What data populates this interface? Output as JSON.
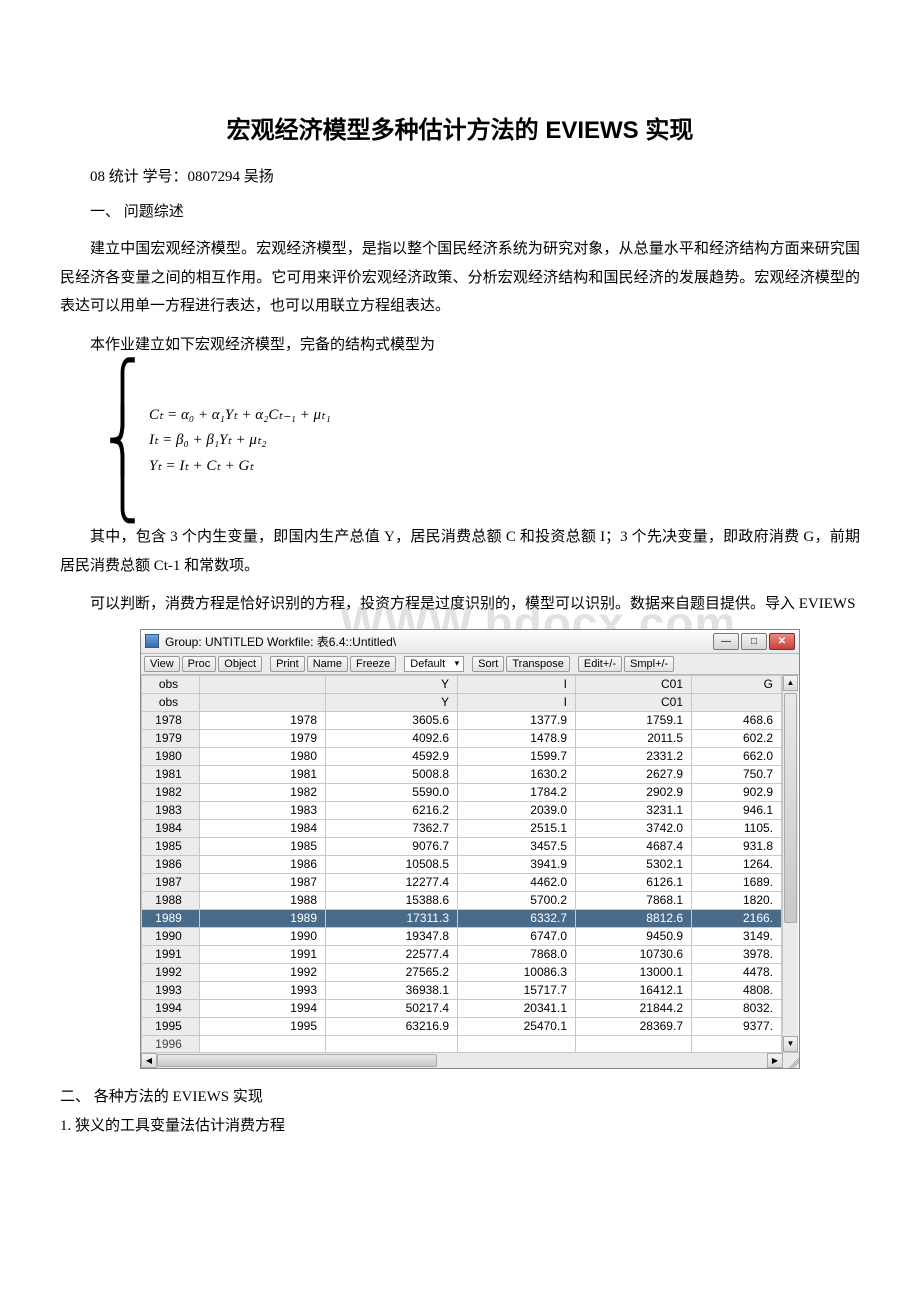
{
  "title": "宏观经济模型多种估计方法的 EVIEWS 实现",
  "byline": "08 统计  学号：0807294   吴扬",
  "section1_head": "一、 问题综述",
  "para1": "建立中国宏观经济模型。宏观经济模型，是指以整个国民经济系统为研究对象，从总量水平和经济结构方面来研究国民经济各变量之间的相互作用。它可用来评价宏观经济政策、分析宏观经济结构和国民经济的发展趋势。宏观经济模型的表达可以用单一方程进行表达，也可以用联立方程组表达。",
  "para2": "本作业建立如下宏观经济模型，完备的结构式模型为",
  "formula": {
    "line1": "Cₜ = α₀ + α₁Yₜ + α₂Cₜ₋₁ + μₜ₁",
    "line2": "Iₜ = β₀ + β₁Yₜ + μₜ₂",
    "line3": "Yₜ = Iₜ + Cₜ + Gₜ"
  },
  "para3": "其中，包含 3 个内生变量，即国内生产总值 Y，居民消费总额 C 和投资总额 I；3 个先决变量，即政府消费 G，前期居民消费总额 Ct-1 和常数项。",
  "para4": "可以判断，消费方程是恰好识别的方程，投资方程是过度识别的，模型可以识别。数据来自题目提供。导入 EVIEWS",
  "watermark": "WWW.bdocx.com",
  "app": {
    "titlebar": "Group: UNTITLED   Workfile: 表6.4::Untitled\\",
    "win_min": "—",
    "win_max": "□",
    "win_close": "✕",
    "toolbar": {
      "view": "View",
      "proc": "Proc",
      "object": "Object",
      "print": "Print",
      "name": "Name",
      "freeze": "Freeze",
      "default_sel": "Default",
      "sort": "Sort",
      "transpose": "Transpose",
      "edit": "Edit+/-",
      "smpl": "Smpl+/-"
    },
    "headers": {
      "obs": "obs",
      "c1": "",
      "c2": "Y",
      "c3": "I",
      "c4": "C01",
      "c5": "G"
    },
    "headers2": {
      "obs": "obs",
      "c1": "",
      "c2": "Y",
      "c3": "I",
      "c4": "C01",
      "c5": ""
    },
    "rows": [
      {
        "obs": "1978",
        "a": "1978",
        "b": "3605.6",
        "c": "1377.9",
        "d": "1759.1",
        "e": "468.6"
      },
      {
        "obs": "1979",
        "a": "1979",
        "b": "4092.6",
        "c": "1478.9",
        "d": "2011.5",
        "e": "602.2"
      },
      {
        "obs": "1980",
        "a": "1980",
        "b": "4592.9",
        "c": "1599.7",
        "d": "2331.2",
        "e": "662.0"
      },
      {
        "obs": "1981",
        "a": "1981",
        "b": "5008.8",
        "c": "1630.2",
        "d": "2627.9",
        "e": "750.7"
      },
      {
        "obs": "1982",
        "a": "1982",
        "b": "5590.0",
        "c": "1784.2",
        "d": "2902.9",
        "e": "902.9"
      },
      {
        "obs": "1983",
        "a": "1983",
        "b": "6216.2",
        "c": "2039.0",
        "d": "3231.1",
        "e": "946.1"
      },
      {
        "obs": "1984",
        "a": "1984",
        "b": "7362.7",
        "c": "2515.1",
        "d": "3742.0",
        "e": "1105."
      },
      {
        "obs": "1985",
        "a": "1985",
        "b": "9076.7",
        "c": "3457.5",
        "d": "4687.4",
        "e": "931.8"
      },
      {
        "obs": "1986",
        "a": "1986",
        "b": "10508.5",
        "c": "3941.9",
        "d": "5302.1",
        "e": "1264."
      },
      {
        "obs": "1987",
        "a": "1987",
        "b": "12277.4",
        "c": "4462.0",
        "d": "6126.1",
        "e": "1689."
      },
      {
        "obs": "1988",
        "a": "1988",
        "b": "15388.6",
        "c": "5700.2",
        "d": "7868.1",
        "e": "1820."
      },
      {
        "obs": "1989",
        "a": "1989",
        "b": "17311.3",
        "c": "6332.7",
        "d": "8812.6",
        "e": "2166.",
        "sel": true
      },
      {
        "obs": "1990",
        "a": "1990",
        "b": "19347.8",
        "c": "6747.0",
        "d": "9450.9",
        "e": "3149."
      },
      {
        "obs": "1991",
        "a": "1991",
        "b": "22577.4",
        "c": "7868.0",
        "d": "10730.6",
        "e": "3978."
      },
      {
        "obs": "1992",
        "a": "1992",
        "b": "27565.2",
        "c": "10086.3",
        "d": "13000.1",
        "e": "4478."
      },
      {
        "obs": "1993",
        "a": "1993",
        "b": "36938.1",
        "c": "15717.7",
        "d": "16412.1",
        "e": "4808."
      },
      {
        "obs": "1994",
        "a": "1994",
        "b": "50217.4",
        "c": "20341.1",
        "d": "21844.2",
        "e": "8032."
      },
      {
        "obs": "1995",
        "a": "1995",
        "b": "63216.9",
        "c": "25470.1",
        "d": "28369.7",
        "e": "9377."
      }
    ],
    "partial_row": {
      "obs": "1996"
    }
  },
  "section2_head": "二、 各种方法的 EVIEWS 实现",
  "section2_sub1": "1. 狭义的工具变量法估计消费方程"
}
